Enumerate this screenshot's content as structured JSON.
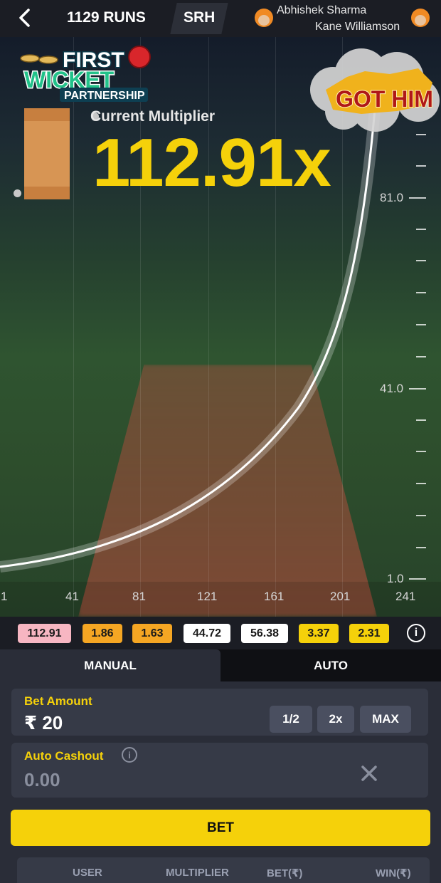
{
  "header": {
    "runs": "1129 RUNS",
    "team": "SRH",
    "player1": "Abhishek Sharma",
    "player2": "Kane Williamson"
  },
  "game": {
    "logo_line1": "FIRST",
    "logo_line2": "WICKET",
    "logo_line3": "PARTNERSHIP",
    "badge": "GOT HIM",
    "multiplier_label": "Current Multiplier",
    "multiplier_value": "112.91x",
    "y_labels": [
      "81.0",
      "41.0",
      "1.0"
    ],
    "x_labels": [
      "1",
      "41",
      "81",
      "121",
      "161",
      "201",
      "241"
    ]
  },
  "history": [
    {
      "value": "112.91",
      "color": "#f7b6c2"
    },
    {
      "value": "1.86",
      "color": "#f5a623"
    },
    {
      "value": "1.63",
      "color": "#f5a623"
    },
    {
      "value": "44.72",
      "color": "#ffffff"
    },
    {
      "value": "56.38",
      "color": "#ffffff"
    },
    {
      "value": "3.37",
      "color": "#f5d10a"
    },
    {
      "value": "2.31",
      "color": "#f5d10a"
    }
  ],
  "tabs": {
    "manual": "MANUAL",
    "auto": "AUTO"
  },
  "bet_amount": {
    "label": "Bet Amount",
    "value": "₹ 20",
    "half": "1/2",
    "double": "2x",
    "max": "MAX"
  },
  "auto_cashout": {
    "label": "Auto Cashout",
    "value": "0.00"
  },
  "bet_button": "BET",
  "table": {
    "user": "USER",
    "multiplier": "MULTIPLIER",
    "bet": "BET(₹)",
    "win": "WIN(₹)"
  },
  "colors": {
    "accent": "#f5d10a",
    "panel": "#2a2d38",
    "card": "#363a47"
  }
}
